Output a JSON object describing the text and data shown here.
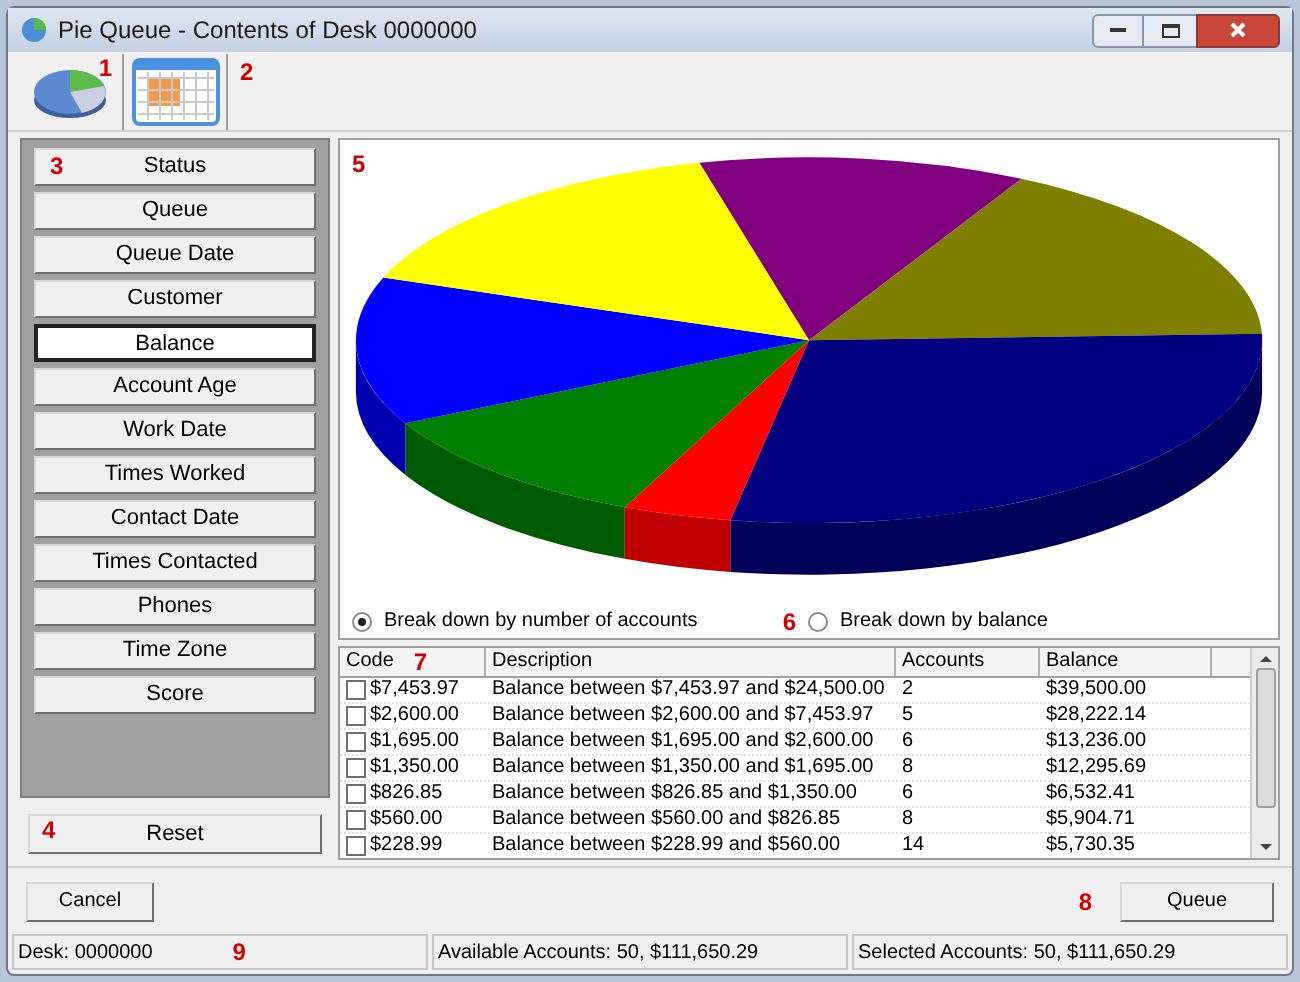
{
  "window": {
    "title": "Pie Queue - Contents of Desk 0000000"
  },
  "toolbar": {
    "callouts": [
      "1",
      "2"
    ]
  },
  "sort_buttons": [
    {
      "label": "Status",
      "selected": false
    },
    {
      "label": "Queue",
      "selected": false
    },
    {
      "label": "Queue Date",
      "selected": false
    },
    {
      "label": "Customer",
      "selected": false
    },
    {
      "label": "Balance",
      "selected": true
    },
    {
      "label": "Account Age",
      "selected": false
    },
    {
      "label": "Work Date",
      "selected": false
    },
    {
      "label": "Times Worked",
      "selected": false
    },
    {
      "label": "Contact Date",
      "selected": false
    },
    {
      "label": "Times Contacted",
      "selected": false
    },
    {
      "label": "Phones",
      "selected": false
    },
    {
      "label": "Time Zone",
      "selected": false
    },
    {
      "label": "Score",
      "selected": false
    }
  ],
  "sort_callout": "3",
  "reset": {
    "label": "Reset",
    "callout": "4"
  },
  "chart": {
    "callout": "5"
  },
  "breakdown": {
    "options": [
      {
        "label": "Break down by number of accounts",
        "selected": true
      },
      {
        "label": "Break down by balance",
        "selected": false
      }
    ],
    "callout": "6"
  },
  "table": {
    "columns": [
      "Code",
      "Description",
      "Accounts",
      "Balance"
    ],
    "callout": "7",
    "rows": [
      {
        "checked": false,
        "cells": [
          "$7,453.97",
          "Balance between $7,453.97 and $24,500.00",
          "2",
          "$39,500.00"
        ]
      },
      {
        "checked": false,
        "cells": [
          "$2,600.00",
          "Balance between $2,600.00 and $7,453.97",
          "5",
          "$28,222.14"
        ]
      },
      {
        "checked": false,
        "cells": [
          "$1,695.00",
          "Balance between $1,695.00 and $2,600.00",
          "6",
          "$13,236.00"
        ]
      },
      {
        "checked": false,
        "cells": [
          "$1,350.00",
          "Balance between $1,350.00 and $1,695.00",
          "8",
          "$12,295.69"
        ]
      },
      {
        "checked": false,
        "cells": [
          "$826.85",
          "Balance between $826.85 and $1,350.00",
          "6",
          "$6,532.41"
        ]
      },
      {
        "checked": false,
        "cells": [
          "$560.00",
          "Balance between $560.00 and $826.85",
          "8",
          "$5,904.71"
        ]
      },
      {
        "checked": false,
        "cells": [
          "$228.99",
          "Balance between $228.99 and $560.00",
          "14",
          "$5,730.35"
        ]
      }
    ]
  },
  "buttons": {
    "cancel": "Cancel",
    "queue": "Queue",
    "callout": "8"
  },
  "status_bar": {
    "segments": [
      "Desk: 0000000",
      "Available Accounts: 50, $111,650.29",
      "Selected Accounts: 50, $111,650.29"
    ],
    "callout": "9"
  }
}
